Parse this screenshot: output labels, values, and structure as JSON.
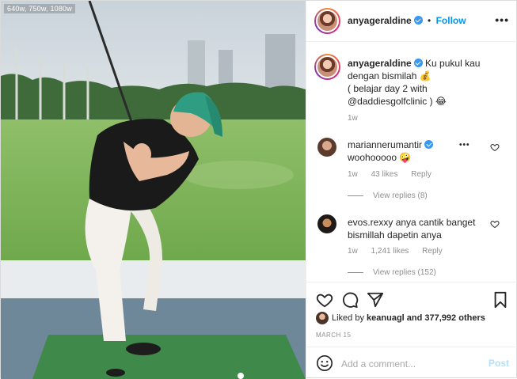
{
  "photo": {
    "size_label": "640w, 750w, 1080w"
  },
  "header": {
    "username": "anyageraldine",
    "separator": "•",
    "follow_label": "Follow",
    "more_label": "•••"
  },
  "caption": {
    "username": "anyageraldine",
    "text": "Ku pukul kau dengan bismilah 💰\n( belajar day 2 with @daddiesgolfclinic ) 😂",
    "time": "1w"
  },
  "comments": [
    {
      "username": "mariannerumantir",
      "verified": true,
      "text": "woohooooo 🤪",
      "time": "1w",
      "likes": "43 likes",
      "reply_label": "Reply",
      "view_replies": "View replies (8)"
    },
    {
      "username": "evos.rexxy",
      "verified": false,
      "text": "anya cantik banget bismillah dapetin anya",
      "time": "1w",
      "likes": "1,241 likes",
      "reply_label": "Reply",
      "view_replies": "View replies (152)"
    }
  ],
  "actions": {
    "liked_by_prefix": "Liked by",
    "liked_by_user": "keanuagl",
    "liked_by_suffix": "and 377,992 others",
    "date": "MARCH 15"
  },
  "add_comment": {
    "placeholder": "Add a comment...",
    "post_label": "Post"
  },
  "icons": [
    "heart-icon",
    "comment-icon",
    "share-icon",
    "bookmark-icon",
    "smile-icon",
    "more-icon",
    "verified-icon"
  ],
  "colors": {
    "accent": "#0095f6",
    "verified": "#3897f0",
    "muted": "#8e8e8e",
    "border": "#efefef"
  }
}
